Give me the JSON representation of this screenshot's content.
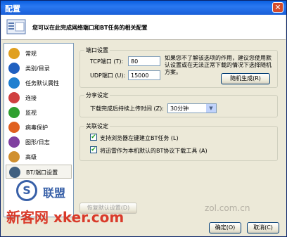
{
  "window": {
    "title": "配置",
    "close": "✕"
  },
  "header": {
    "text": "您可以在此完成网络端口和BT任务的相关配置"
  },
  "sidebar": {
    "items": [
      {
        "label": "常规",
        "color": "#e0a020"
      },
      {
        "label": "类别/目录",
        "color": "#2060c0"
      },
      {
        "label": "任务默认属性",
        "color": "#2080d0"
      },
      {
        "label": "连接",
        "color": "#d04040"
      },
      {
        "label": "监视",
        "color": "#30a030"
      },
      {
        "label": "病毒保护",
        "color": "#e06020"
      },
      {
        "label": "图形/日志",
        "color": "#8040a0"
      },
      {
        "label": "高级",
        "color": "#d09030"
      },
      {
        "label": "BT/端口设置",
        "color": "#406080",
        "selected": true
      }
    ]
  },
  "port": {
    "title": "端口设置",
    "tcp_label": "TCP端口 (T):",
    "tcp_value": "80",
    "udp_label": "UDP端口 (U):",
    "udp_value": "15000",
    "note": "如果您不了解该选项的作用，建议您使用默认设置或在无法正常下载的情况下选择随机方案。",
    "random_button": "随机生成(R)"
  },
  "share": {
    "title": "分享设定",
    "label": "下载完成后持续上传时间 (Z):",
    "value": "30分钟"
  },
  "assoc": {
    "title": "关联设定",
    "opt1": "支持浏览器左键建立BT任务 (L)",
    "opt2": "将迅雷作为本机默认的BT协议下载工具 (A)"
  },
  "buttons": {
    "restore": "恢复默认设置(D)",
    "ok": "确定(O)",
    "cancel": "取消(C)"
  },
  "watermarks": {
    "site": "新客网 xker.com",
    "zol": "zol.com.cn",
    "logo": "S",
    "logo_text": "联盟"
  }
}
